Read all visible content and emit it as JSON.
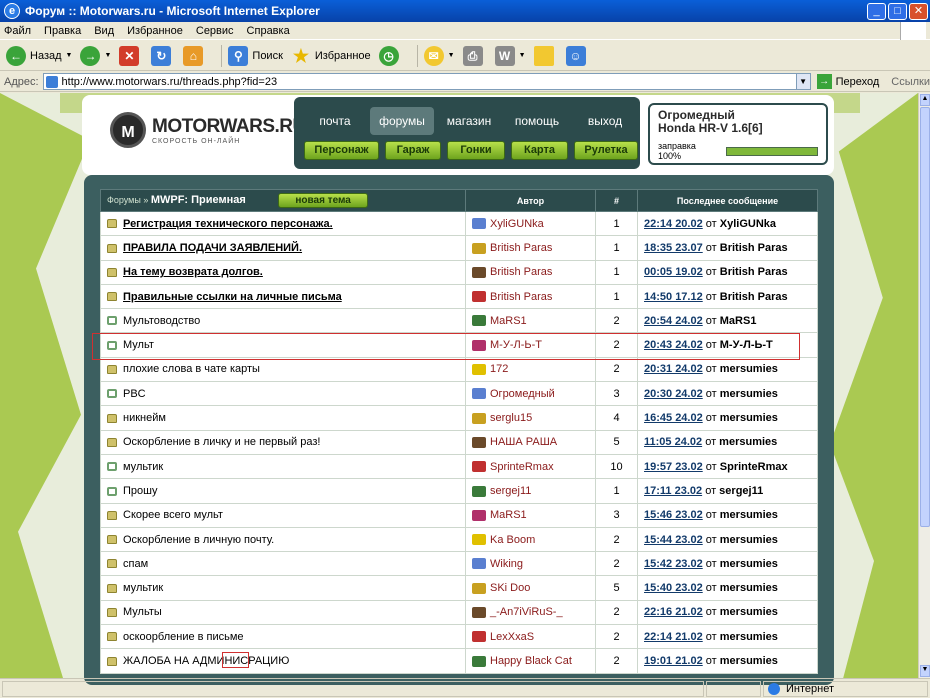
{
  "window": {
    "title": "Форум :: Motorwars.ru - Microsoft Internet Explorer"
  },
  "menu": [
    "Файл",
    "Правка",
    "Вид",
    "Избранное",
    "Сервис",
    "Справка"
  ],
  "toolbar": {
    "back": "Назад",
    "search": "Поиск",
    "favorites": "Избранное"
  },
  "address": {
    "label": "Адрес:",
    "url": "http://www.motorwars.ru/threads.php?fid=23",
    "go": "Переход",
    "links": "Ссылки"
  },
  "site": {
    "brand": "MOTORWARS.RU",
    "slogan": "СКОРОСТЬ ОН-ЛАЙН",
    "nav": [
      "почта",
      "форумы",
      "магазин",
      "помощь",
      "выход"
    ],
    "buttons": [
      "Персонаж",
      "Гараж",
      "Гонки",
      "Карта",
      "Рулетка"
    ],
    "user": {
      "name": "Огромедный",
      "car": "Honda HR-V 1.6[6]",
      "fuel_label": "заправка 100%",
      "fuel_fraction": 1.0
    }
  },
  "forum": {
    "crumb_root": "Форумы",
    "crumb_current": "MWPF: Приемная",
    "new_thread": "новая тема",
    "col_author": "Автор",
    "col_count": "#",
    "col_last": "Последнее сообщение",
    "from_word": "от",
    "threads": [
      {
        "icon": "lock",
        "title": "Регистрация технического персонажа.",
        "bold": true,
        "author": "XyliGUNka",
        "count": "1",
        "time": "22:14 20.02",
        "last_by": "XyliGUNka"
      },
      {
        "icon": "lock",
        "title": "ПРАВИЛА ПОДАЧИ ЗАЯВЛЕНИЙ.",
        "bold": true,
        "author": "British Paras",
        "count": "1",
        "time": "18:35 23.07",
        "last_by": "British Paras"
      },
      {
        "icon": "lock",
        "title": "На тему возврата долгов.",
        "bold": true,
        "author": "British Paras",
        "count": "1",
        "time": "00:05 19.02",
        "last_by": "British Paras"
      },
      {
        "icon": "lock",
        "title": "Правильные ссылки на личные письма",
        "bold": true,
        "author": "British Paras",
        "count": "1",
        "time": "14:50 17.12",
        "last_by": "British Paras"
      },
      {
        "icon": "chat",
        "title": "Мультоводство",
        "bold": false,
        "author": "MaRS1",
        "count": "2",
        "time": "20:54 24.02",
        "last_by": "MaRS1"
      },
      {
        "icon": "chat",
        "title": "Мульт",
        "bold": false,
        "author": "М-У-Л-Ь-Т",
        "count": "2",
        "time": "20:43 24.02",
        "last_by": "М-У-Л-Ь-Т"
      },
      {
        "icon": "lock",
        "title": "плохие слова в чате карты",
        "bold": false,
        "author": "172",
        "count": "2",
        "time": "20:31 24.02",
        "last_by": "mersumies"
      },
      {
        "icon": "chat",
        "title": "PBC",
        "bold": false,
        "author": "Огромедный",
        "count": "3",
        "time": "20:30 24.02",
        "last_by": "mersumies"
      },
      {
        "icon": "lock",
        "title": "никнейм",
        "bold": false,
        "author": "serglu15",
        "count": "4",
        "time": "16:45 24.02",
        "last_by": "mersumies"
      },
      {
        "icon": "lock",
        "title": "Оскорбление в личку и не первый раз!",
        "bold": false,
        "author": "НАША РАША",
        "count": "5",
        "time": "11:05 24.02",
        "last_by": "mersumies"
      },
      {
        "icon": "chat",
        "title": "мультик",
        "bold": false,
        "author": "SprinteRmax",
        "count": "10",
        "time": "19:57 23.02",
        "last_by": "SprinteRmax"
      },
      {
        "icon": "chat",
        "title": "Прошу",
        "bold": false,
        "author": "sergej11",
        "count": "1",
        "time": "17:11 23.02",
        "last_by": "sergej11"
      },
      {
        "icon": "lock",
        "title": "Скорее всего мульт",
        "bold": false,
        "author": "MaRS1",
        "count": "3",
        "time": "15:46 23.02",
        "last_by": "mersumies"
      },
      {
        "icon": "lock",
        "title": "Оскорбление в личную почту.",
        "bold": false,
        "author": "Ka Boom",
        "count": "2",
        "time": "15:44 23.02",
        "last_by": "mersumies"
      },
      {
        "icon": "lock",
        "title": "спам",
        "bold": false,
        "author": "Wiking",
        "count": "2",
        "time": "15:42 23.02",
        "last_by": "mersumies"
      },
      {
        "icon": "lock",
        "title": "мультик",
        "bold": false,
        "author": "SKi Doo",
        "count": "5",
        "time": "15:40 23.02",
        "last_by": "mersumies"
      },
      {
        "icon": "lock",
        "title": "Мульты",
        "bold": false,
        "author": "_-An7iViRuS-_",
        "count": "2",
        "time": "22:16 21.02",
        "last_by": "mersumies"
      },
      {
        "icon": "lock",
        "title": "оскоорбление в письме",
        "bold": false,
        "author": "LexXxaS",
        "count": "2",
        "time": "22:14 21.02",
        "last_by": "mersumies"
      },
      {
        "icon": "lock",
        "title": "ЖАЛОБА НА АДМИНИСРАЦИЮ",
        "bold": false,
        "author": "Happy Black Cat",
        "count": "2",
        "time": "19:01 21.02",
        "last_by": "mersumies"
      }
    ]
  },
  "status": {
    "zone": "Интернет"
  },
  "colors": {
    "accent": "#2c4b4c",
    "green_button": "#8cc63f",
    "highlight": "#d03030"
  }
}
